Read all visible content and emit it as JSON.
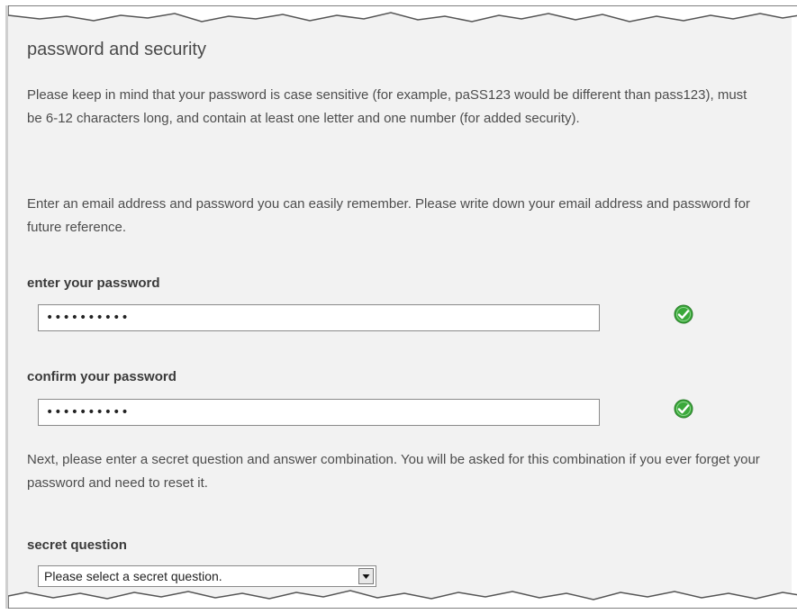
{
  "section": {
    "title": "password and security",
    "intro": "Please keep in mind that your password is case sensitive (for example, paSS123 would be different than pass123), must be 6-12 characters long, and contain at least one letter and one number (for added security).",
    "instructions": "Enter an email address and password you can easily remember. Please write down your email address and password for future reference."
  },
  "password": {
    "label": "enter your password",
    "value": "••••••••••",
    "valid": true,
    "status_icon": "check-circle-icon"
  },
  "confirm": {
    "label": "confirm your password",
    "value": "••••••••••",
    "valid": true,
    "status_icon": "check-circle-icon"
  },
  "secret": {
    "intro": "Next, please enter a secret question and answer combination. You will be asked for this combination if you ever forget your password and need to reset it.",
    "label": "secret question",
    "selected": "Please select a secret question."
  },
  "colors": {
    "panel_bg": "#f2f2f2",
    "valid_green": "#3aa83a"
  }
}
